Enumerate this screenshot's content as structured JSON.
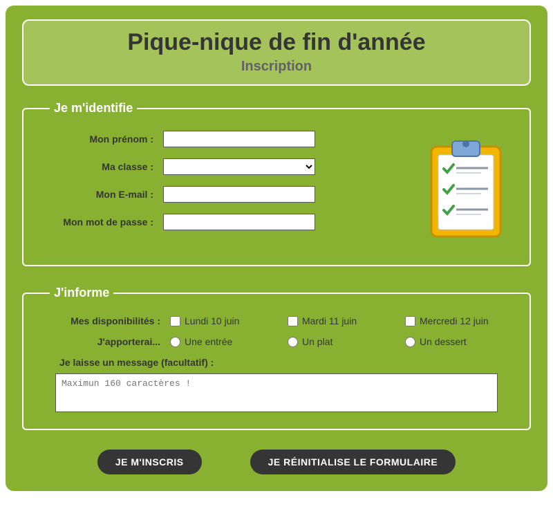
{
  "header": {
    "title": "Pique-nique de fin d'année",
    "subtitle": "Inscription"
  },
  "identify": {
    "legend": "Je m'identifie",
    "prenom_label": "Mon prénom :",
    "classe_label": "Ma classe :",
    "email_label": "Mon E-mail :",
    "password_label": "Mon mot de passe :"
  },
  "inform": {
    "legend": "J'informe",
    "dispo_label": "Mes disponibilités :",
    "dispo_options": {
      "o1": "Lundi 10 juin",
      "o2": "Mardi 11 juin",
      "o3": "Mercredi 12 juin"
    },
    "apport_label": "J'apporterai...",
    "apport_options": {
      "o1": "Une entrée",
      "o2": "Un plat",
      "o3": "Un dessert"
    },
    "message_label": "Je laisse un message (facultatif) :",
    "message_placeholder": "Maximun 160 caractères !"
  },
  "buttons": {
    "submit": "JE M'INSCRIS",
    "reset": "JE RÉINITIALISE LE FORMULAIRE"
  }
}
